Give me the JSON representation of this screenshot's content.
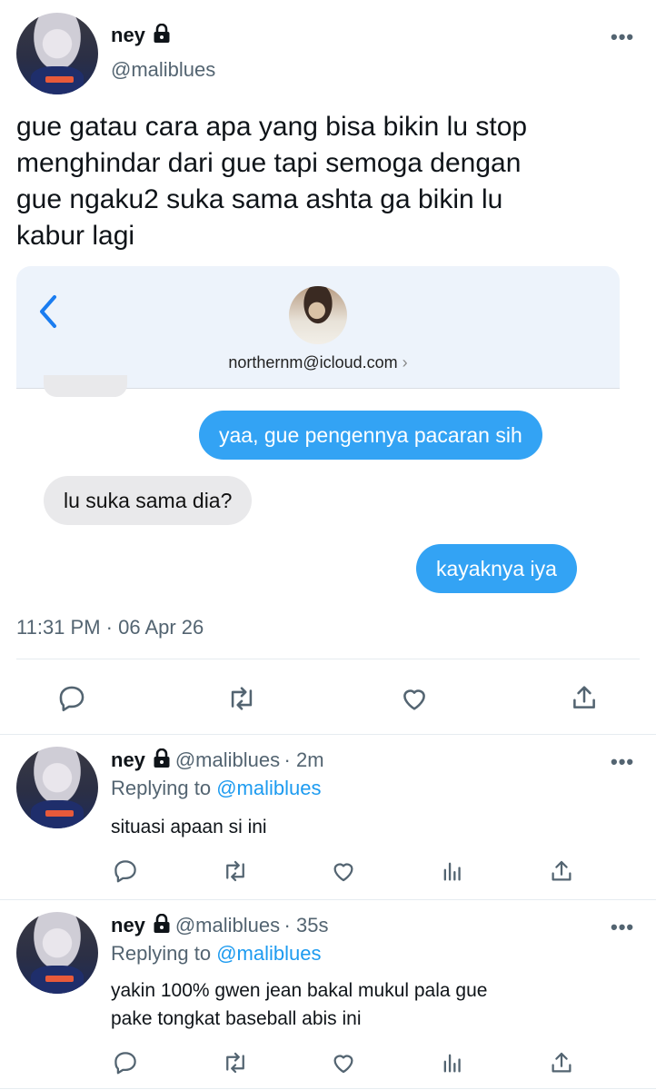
{
  "main_tweet": {
    "author_name": "ney",
    "author_handle": "@maliblues",
    "text_lines": [
      "gue gatau cara apa yang bisa bikin lu stop",
      "menghindar dari gue tapi semoga dengan",
      "gue ngaku2 suka sama ashta ga bikin lu",
      "kabur lagi"
    ],
    "timestamp": "11:31 PM · 06 Apr 26"
  },
  "chat": {
    "contact": "northernm@icloud.com",
    "messages": [
      {
        "side": "me",
        "text": "yaa, gue pengennya pacaran sih"
      },
      {
        "side": "them",
        "text": "lu suka sama dia?"
      },
      {
        "side": "me",
        "text": "kayaknya iya"
      }
    ]
  },
  "replies": [
    {
      "author_name": "ney",
      "author_handle": "@maliblues",
      "time": "· 2m",
      "replying_prefix": "Replying to ",
      "replying_handle": "@maliblues",
      "text_lines": [
        "situasi apaan si ini"
      ]
    },
    {
      "author_name": "ney",
      "author_handle": "@maliblues",
      "time": "· 35s",
      "replying_prefix": "Replying to ",
      "replying_handle": "@maliblues",
      "text_lines": [
        "yakin 100% gwen jean bakal mukul pala gue",
        "pake tongkat baseball abis ini"
      ]
    }
  ],
  "icons": [
    "lock-icon",
    "more-icon",
    "back-chevron-icon",
    "reply-icon",
    "retweet-icon",
    "like-icon",
    "share-icon",
    "analytics-icon"
  ],
  "colors": {
    "link": "#1d9bf0",
    "bubble_me": "#33a3f4",
    "bubble_them": "#e9e9eb",
    "muted": "#536471"
  }
}
